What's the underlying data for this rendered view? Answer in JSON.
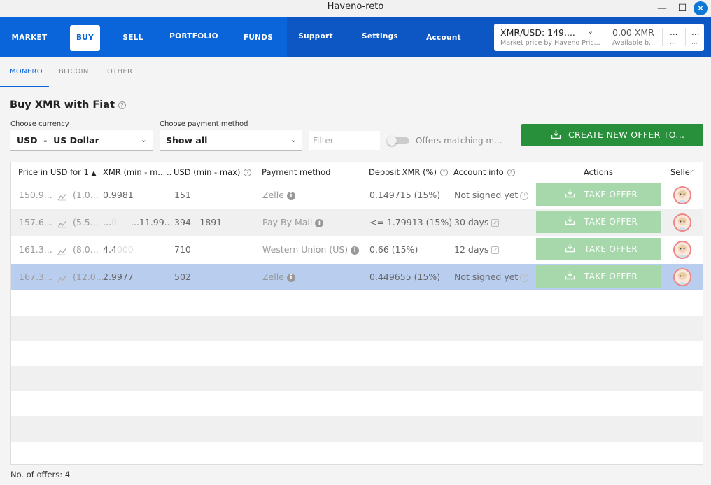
{
  "window": {
    "title": "Haveno-reto",
    "min": "—",
    "max": "☐",
    "close": "✕"
  },
  "nav": {
    "items": [
      {
        "label": "MARKET"
      },
      {
        "label": "BUY"
      },
      {
        "label": "SELL"
      },
      {
        "label": "PORTFOLIO"
      },
      {
        "label": "FUNDS"
      },
      {
        "label": "Support"
      },
      {
        "label": "Settings"
      },
      {
        "label": "Account"
      }
    ],
    "active": "BUY",
    "price": {
      "value": "XMR/USD: 149....",
      "sub": "Market price by Haveno Pric..."
    },
    "balance": {
      "value": "0.00 XMR",
      "sub": "Available b..."
    },
    "extra1": {
      "value": "...",
      "sub": "..."
    },
    "extra2": {
      "value": "...",
      "sub": "..."
    }
  },
  "subtabs": [
    {
      "label": "MONERO"
    },
    {
      "label": "BITCOIN"
    },
    {
      "label": "OTHER"
    }
  ],
  "page": {
    "heading": "Buy XMR with Fiat",
    "currency_label": "Choose currency",
    "currency_value": "USD  -  US Dollar",
    "payment_label": "Choose payment method",
    "payment_value": "Show all",
    "filter_placeholder": "Filter",
    "toggle_label": "Offers matching m...",
    "create_button": "CREATE NEW OFFER TO..."
  },
  "table": {
    "headers": {
      "price": "Price in USD for 1",
      "xmr": "XMR (min - m...",
      "more": "..",
      "usd": "USD (min - max)",
      "payment": "Payment method",
      "deposit": "Deposit XMR (%)",
      "account": "Account info",
      "actions": "Actions",
      "seller": "Seller"
    },
    "rows": [
      {
        "price": "150.9...",
        "pct": "(1.0...",
        "xmr": "0.9981",
        "xmr_max": "",
        "usd": "151",
        "payment": "Zelle",
        "deposit": "0.149715 (15%)",
        "account": "Not signed yet",
        "account_icon": "warn",
        "action": "TAKE OFFER"
      },
      {
        "price": "157.6...",
        "pct": "(5.5...",
        "xmr": "...",
        "xmr_max": "...11.99...",
        "xmr_faint": "0.",
        "usd": "394 - 1891",
        "payment": "Pay By Mail",
        "deposit": "<= 1.79913 (15%)",
        "account": "30 days",
        "account_icon": "check",
        "action": "TAKE OFFER"
      },
      {
        "price": "161.3...",
        "pct": "(8.0...",
        "xmr": "4.4",
        "xmr_faint": "000",
        "xmr_max": "",
        "usd": "710",
        "payment": "Western Union (US)",
        "deposit": "0.66 (15%)",
        "account": "12 days",
        "account_icon": "check",
        "action": "TAKE OFFER"
      },
      {
        "price": "167.3...",
        "pct": "(12.0...",
        "xmr": "2.9977",
        "xmr_max": "",
        "usd": "502",
        "payment": "Zelle",
        "deposit": "0.449655 (15%)",
        "account": "Not signed yet",
        "account_icon": "warn",
        "action": "TAKE OFFER"
      }
    ]
  },
  "footer": "No. of offers: 4",
  "colors": {
    "nav": "#0b65da",
    "nav_dark": "#0d57c4",
    "create": "#28903a",
    "take": "#a6d8ab",
    "selected": "#b9cdef"
  }
}
